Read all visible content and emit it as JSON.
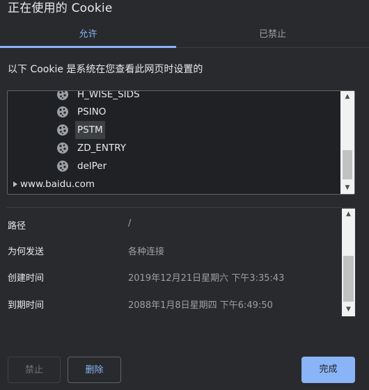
{
  "dialog": {
    "title": "正在使用的 Cookie"
  },
  "tabs": [
    {
      "label": "允许",
      "active": true
    },
    {
      "label": "已禁止",
      "active": false
    }
  ],
  "section_desc": "以下 Cookie 是系统在您查看此网页时设置的",
  "tree": {
    "items": [
      {
        "label": "H_WISE_SIDS",
        "type": "cookie",
        "selected": false
      },
      {
        "label": "PSINO",
        "type": "cookie",
        "selected": false
      },
      {
        "label": "PSTM",
        "type": "cookie",
        "selected": true
      },
      {
        "label": "ZD_ENTRY",
        "type": "cookie",
        "selected": false
      },
      {
        "label": "delPer",
        "type": "cookie",
        "selected": false
      },
      {
        "label": "www.baidu.com",
        "type": "site",
        "selected": false
      }
    ]
  },
  "details": {
    "rows": [
      {
        "key": "路径",
        "value": "/"
      },
      {
        "key": "为何发送",
        "value": "各种连接"
      },
      {
        "key": "创建时间",
        "value": "2019年12月21日星期六 下午3:35:43"
      },
      {
        "key": "到期时间",
        "value": "2088年1月8日星期四 下午6:49:50"
      }
    ]
  },
  "buttons": {
    "block": "禁止",
    "delete": "删除",
    "done": "完成"
  },
  "colors": {
    "background": "#292a2d",
    "accent": "#8ab4f8",
    "text": "#e8eaed",
    "muted": "#9aa0a6"
  }
}
